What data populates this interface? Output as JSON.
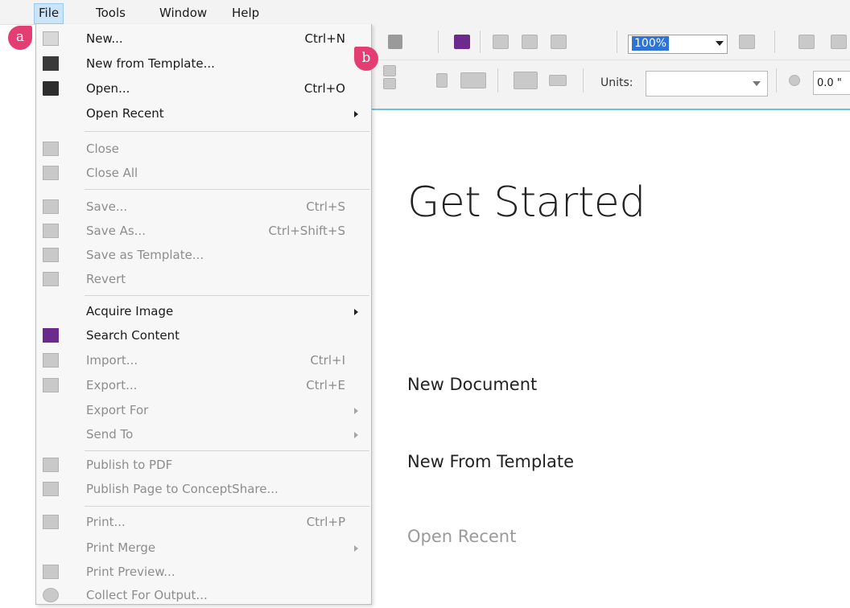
{
  "menubar": {
    "items": [
      {
        "label": "File",
        "active": true
      },
      {
        "label": "Tools",
        "active": false
      },
      {
        "label": "Window",
        "active": false
      },
      {
        "label": "Help",
        "active": false
      }
    ]
  },
  "toolbar": {
    "zoom_value": "100%",
    "units_label": "Units:",
    "units_value": "",
    "nudge_value": "0.0 \""
  },
  "file_menu": {
    "items": [
      {
        "label": "New...",
        "shortcut": "Ctrl+N",
        "icon": "new-document-icon",
        "disabled": false
      },
      {
        "label": "New from Template...",
        "shortcut": "",
        "icon": "new-from-template-icon",
        "disabled": false
      },
      {
        "label": "Open...",
        "shortcut": "Ctrl+O",
        "icon": "folder-icon",
        "disabled": false
      },
      {
        "label": "Open Recent",
        "shortcut": "",
        "icon": "",
        "disabled": false,
        "submenu": true
      },
      {
        "label": "Close",
        "shortcut": "",
        "icon": "close-icon",
        "disabled": true
      },
      {
        "label": "Close All",
        "shortcut": "",
        "icon": "close-all-icon",
        "disabled": true
      },
      {
        "label": "Save...",
        "shortcut": "Ctrl+S",
        "icon": "save-icon",
        "disabled": true
      },
      {
        "label": "Save As...",
        "shortcut": "Ctrl+Shift+S",
        "icon": "save-as-icon",
        "disabled": true
      },
      {
        "label": "Save as Template...",
        "shortcut": "",
        "icon": "save-template-icon",
        "disabled": true
      },
      {
        "label": "Revert",
        "shortcut": "",
        "icon": "revert-icon",
        "disabled": true
      },
      {
        "label": "Acquire Image",
        "shortcut": "",
        "icon": "",
        "disabled": false,
        "submenu": true
      },
      {
        "label": "Search Content",
        "shortcut": "",
        "icon": "search-content-icon",
        "disabled": false
      },
      {
        "label": "Import...",
        "shortcut": "Ctrl+I",
        "icon": "import-icon",
        "disabled": true
      },
      {
        "label": "Export...",
        "shortcut": "Ctrl+E",
        "icon": "export-icon",
        "disabled": true
      },
      {
        "label": "Export For",
        "shortcut": "",
        "icon": "",
        "disabled": true,
        "submenu": true
      },
      {
        "label": "Send To",
        "shortcut": "",
        "icon": "",
        "disabled": true,
        "submenu": true
      },
      {
        "label": "Publish to PDF",
        "shortcut": "",
        "icon": "pdf-icon",
        "disabled": true
      },
      {
        "label": "Publish Page to ConceptShare...",
        "shortcut": "",
        "icon": "conceptshare-icon",
        "disabled": true
      },
      {
        "label": "Print...",
        "shortcut": "Ctrl+P",
        "icon": "print-icon",
        "disabled": true
      },
      {
        "label": "Print Merge",
        "shortcut": "",
        "icon": "",
        "disabled": true,
        "submenu": true
      },
      {
        "label": "Print Preview...",
        "shortcut": "",
        "icon": "print-preview-icon",
        "disabled": true
      },
      {
        "label": "Collect For Output...",
        "shortcut": "",
        "icon": "collect-output-icon",
        "disabled": true
      }
    ]
  },
  "get_started": {
    "title": "Get Started",
    "new_document": "New Document",
    "new_from_template": "New From Template",
    "open_recent": "Open Recent"
  },
  "callouts": {
    "a": "a",
    "b": "b"
  },
  "colors": {
    "callout": "#e33d72",
    "accent_line": "#6ec3dc",
    "menu_highlight": "#cce4f7"
  }
}
